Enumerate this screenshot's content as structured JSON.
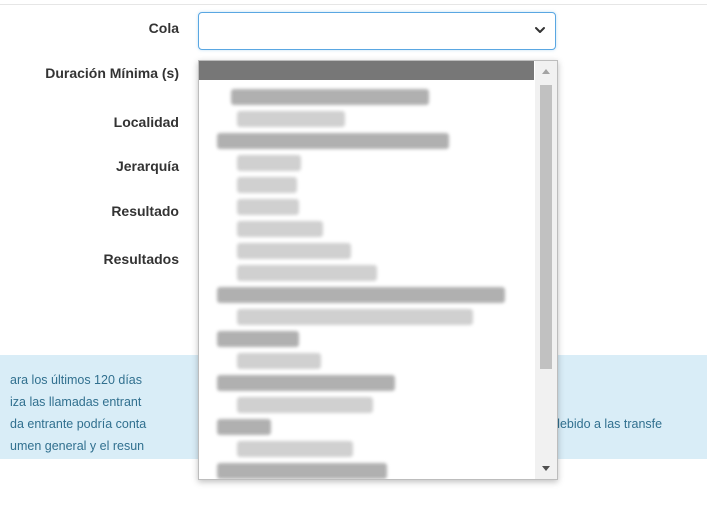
{
  "form": {
    "labels": {
      "cola": "Cola",
      "duracion": "Duración Mínima (s)",
      "localidad": "Localidad",
      "jerarquia": "Jerarquía",
      "resultado": "Resultado",
      "resultados": "Resultados"
    },
    "cola_select": {
      "value": "",
      "icon": "chevron-down-icon"
    }
  },
  "info": {
    "lines": [
      "ara los últimos 120 días",
      "iza las llamadas entrant",
      "da entrante podría conta",
      "umen general y el resun"
    ],
    "line3_tail": "debido a las transfe"
  },
  "dropdown": {
    "highlighted_index": 0,
    "note": "Option labels are blurred/unreadable in the screenshot",
    "colors": {
      "highlight": "#777777",
      "focus_border": "#5aa7e2",
      "panel_bg": "#d9edf7",
      "panel_text": "#31708f"
    }
  }
}
